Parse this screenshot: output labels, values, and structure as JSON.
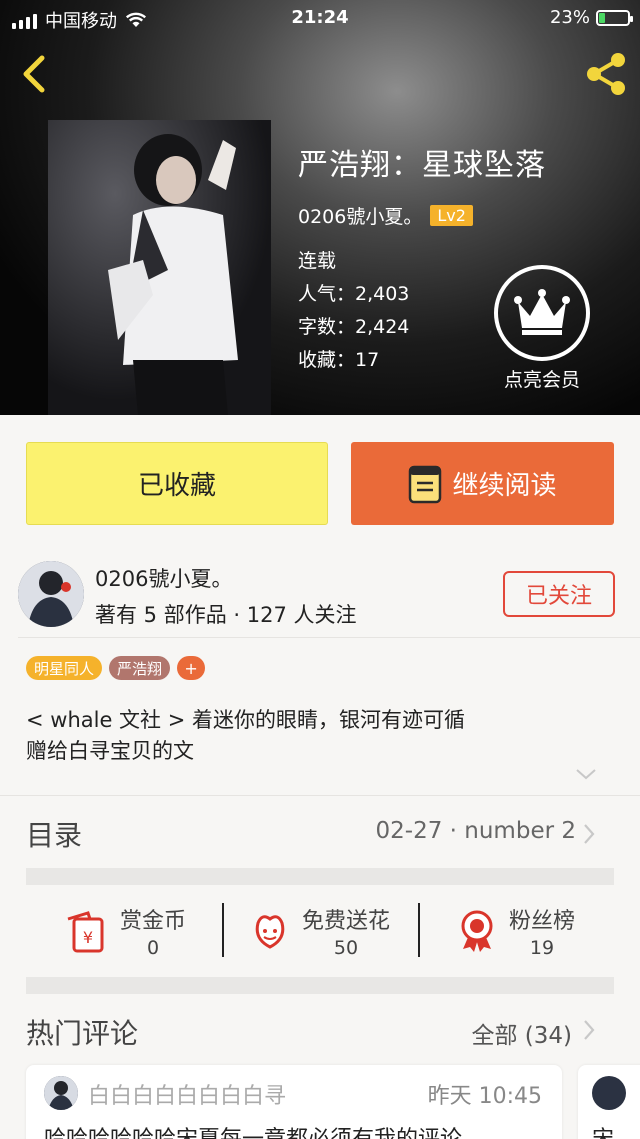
{
  "status_bar": {
    "carrier": "中国移动",
    "time": "21:24",
    "battery_text": "23%",
    "battery_level": 0.23
  },
  "header": {
    "back_icon": "chevron-left-icon",
    "share_icon": "share-icon"
  },
  "book": {
    "title": "严浩翔：星球坠落",
    "author": "0206號小夏。",
    "author_level": "Lv2",
    "serial_status": "连载",
    "popularity": "人气：2,403",
    "word_count": "字数：2,424",
    "favorites": "收藏：17"
  },
  "member": {
    "icon": "crown-icon",
    "label": "点亮会员"
  },
  "actions": {
    "favorite_label": "已收藏",
    "read_label": "继续阅读",
    "read_icon": "book-icon"
  },
  "author_card": {
    "name": "0206號小夏。",
    "meta": "著有 5 部作品 · 127 人关注",
    "follow_label": "已关注"
  },
  "tags": [
    "明星同人",
    "严浩翔",
    "+"
  ],
  "description": {
    "line1": "< whale 文社 > 着迷你的眼睛，银河有迹可循",
    "line2": "赠给白寻宝贝的文"
  },
  "toc": {
    "label": "目录",
    "latest": "02-27 · number 2"
  },
  "stats": [
    {
      "icon": "red-envelope-icon",
      "title": "赏金币",
      "value": "0"
    },
    {
      "icon": "flower-icon",
      "title": "免费送花",
      "value": "50"
    },
    {
      "icon": "medal-icon",
      "title": "粉丝榜",
      "value": "19"
    }
  ],
  "comments": {
    "label": "热门评论",
    "all_label": "全部 (34)",
    "items": [
      {
        "user": "白白白白白白白白寻",
        "time": "昨天 10:45",
        "text": "哈哈哈哈哈哈宋夏每一章都必须有我的评论"
      },
      {
        "text": "宋"
      }
    ]
  },
  "colors": {
    "accent_orange": "#ea6a39",
    "favorite_yellow": "#fbf26f",
    "level_gold": "#f5b22b",
    "follow_red": "#e2483a",
    "icon_red": "#d9352b"
  }
}
